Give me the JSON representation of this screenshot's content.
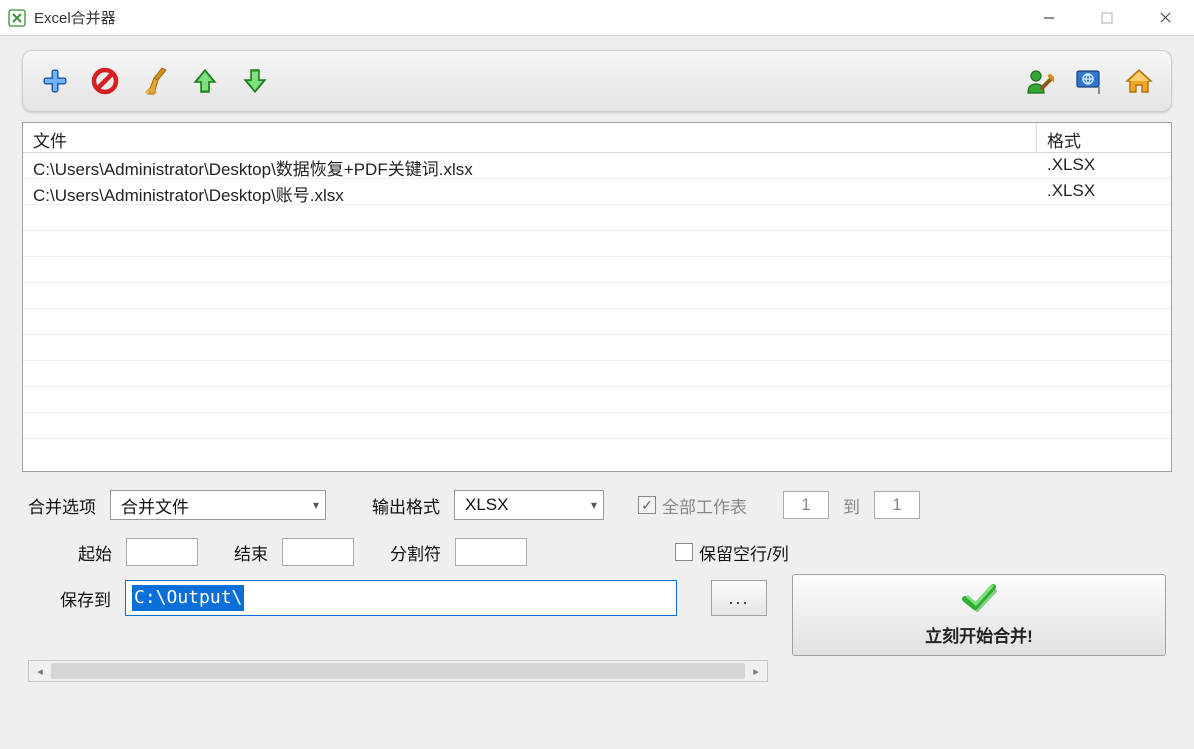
{
  "window": {
    "title": "Excel合并器"
  },
  "toolbar": {
    "icons": {
      "add": "plus-icon",
      "forbid": "forbid-icon",
      "broom": "broom-icon",
      "up": "arrow-up-icon",
      "down": "arrow-down-icon",
      "pin": "pin-icon",
      "flag": "flag-icon",
      "home": "home-icon"
    }
  },
  "table": {
    "headers": {
      "file": "文件",
      "format": "格式"
    },
    "rows": [
      {
        "file": "C:\\Users\\Administrator\\Desktop\\数据恢复+PDF关键词.xlsx",
        "format": ".XLSX"
      },
      {
        "file": "C:\\Users\\Administrator\\Desktop\\账号.xlsx",
        "format": ".XLSX"
      }
    ],
    "empty_rows": 9
  },
  "options": {
    "merge_label": "合并选项",
    "merge_value": "合并文件",
    "output_format_label": "输出格式",
    "output_format_value": "XLSX",
    "all_sheets_label": "全部工作表",
    "all_sheets_checked": true,
    "sheet_from": "1",
    "sheet_to_label": "到",
    "sheet_to": "1",
    "start_label": "起始",
    "start_value": "",
    "end_label": "结束",
    "end_value": "",
    "delimiter_label": "分割符",
    "delimiter_value": "",
    "keep_empty_label": "保留空行/列",
    "keep_empty_checked": false,
    "save_to_label": "保存到",
    "save_to_value": "C:\\Output\\",
    "browse_label": "...",
    "start_merge_label": "立刻开始合并!"
  }
}
